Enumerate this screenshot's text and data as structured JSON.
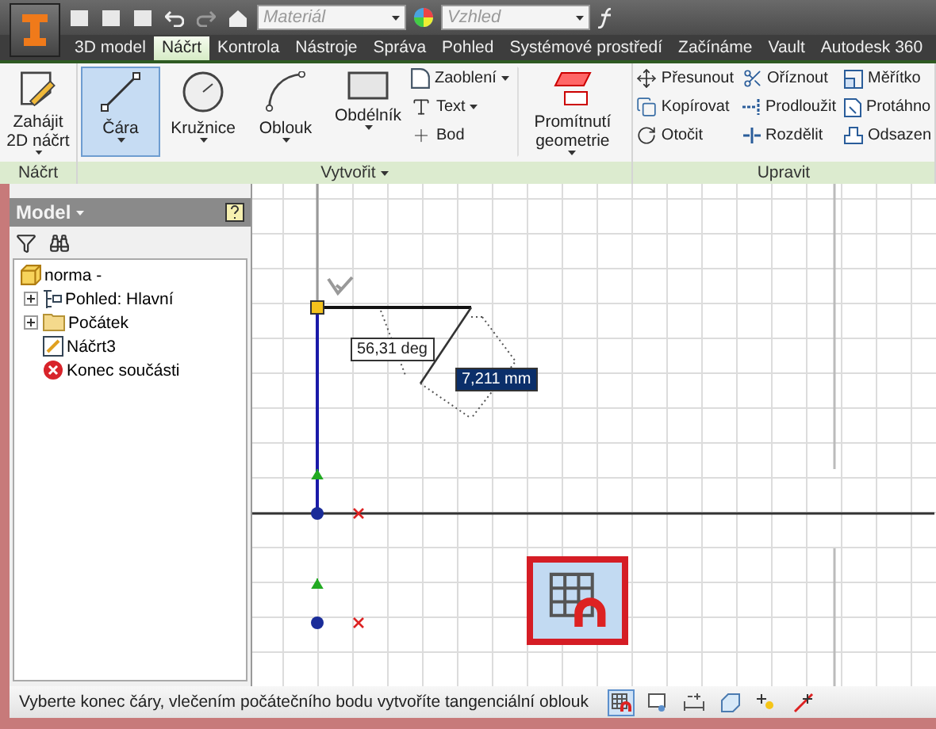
{
  "quick_access": {
    "material": {
      "placeholder": "Materiál"
    },
    "appearance": {
      "placeholder": "Vzhled"
    }
  },
  "tabs": [
    {
      "label": "3D model",
      "selected": false
    },
    {
      "label": "Náčrt",
      "selected": true
    },
    {
      "label": "Kontrola",
      "selected": false
    },
    {
      "label": "Nástroje",
      "selected": false
    },
    {
      "label": "Správa",
      "selected": false
    },
    {
      "label": "Pohled",
      "selected": false
    },
    {
      "label": "Systémové prostředí",
      "selected": false
    },
    {
      "label": "Začínáme",
      "selected": false
    },
    {
      "label": "Vault",
      "selected": false
    },
    {
      "label": "Autodesk 360",
      "selected": false
    }
  ],
  "ribbon": {
    "panels": [
      {
        "title": "Náčrt",
        "large": [
          {
            "label": "Zahájit 2D náčrt",
            "selected": false
          }
        ]
      },
      {
        "title": "Vytvořit",
        "dropdown": true,
        "large": [
          {
            "label": "Čára",
            "selected": true
          },
          {
            "label": "Kružnice",
            "selected": false
          },
          {
            "label": "Oblouk",
            "selected": false
          },
          {
            "label": "Obdélník",
            "selected": false
          }
        ],
        "small": [
          {
            "label": "Zaoblení"
          },
          {
            "label": "Text"
          },
          {
            "label": "Bod"
          }
        ],
        "extra": {
          "label": "Promítnutí geometrie",
          "selected": false
        }
      },
      {
        "title": "Upravit",
        "small": [
          {
            "label": "Přesunout"
          },
          {
            "label": "Kopírovat"
          },
          {
            "label": "Otočit"
          },
          {
            "label": "Oříznout"
          },
          {
            "label": "Prodloužit"
          },
          {
            "label": "Rozdělit"
          },
          {
            "label": "Měřítko"
          },
          {
            "label": "Protáhno"
          },
          {
            "label": "Odsazen"
          }
        ]
      }
    ]
  },
  "browser": {
    "title": "Model",
    "tree": [
      {
        "label": "norma -",
        "children": [
          {
            "label": "Pohled: Hlavní",
            "expanded": false
          },
          {
            "label": "Počátek",
            "expanded": false
          },
          {
            "label": "Náčrt3"
          },
          {
            "label": "Konec součásti"
          }
        ]
      }
    ]
  },
  "canvas": {
    "angle_value": "56,31 deg",
    "length_value": "7,211 mm"
  },
  "status_bar": {
    "message": "Vyberte konec čáry, vlečením počátečního bodu vytvoříte tangenciální oblouk",
    "icons": [
      {
        "on": true
      },
      {
        "on": false
      },
      {
        "on": false
      },
      {
        "on": false
      },
      {
        "on": false
      },
      {
        "on": false
      }
    ]
  }
}
